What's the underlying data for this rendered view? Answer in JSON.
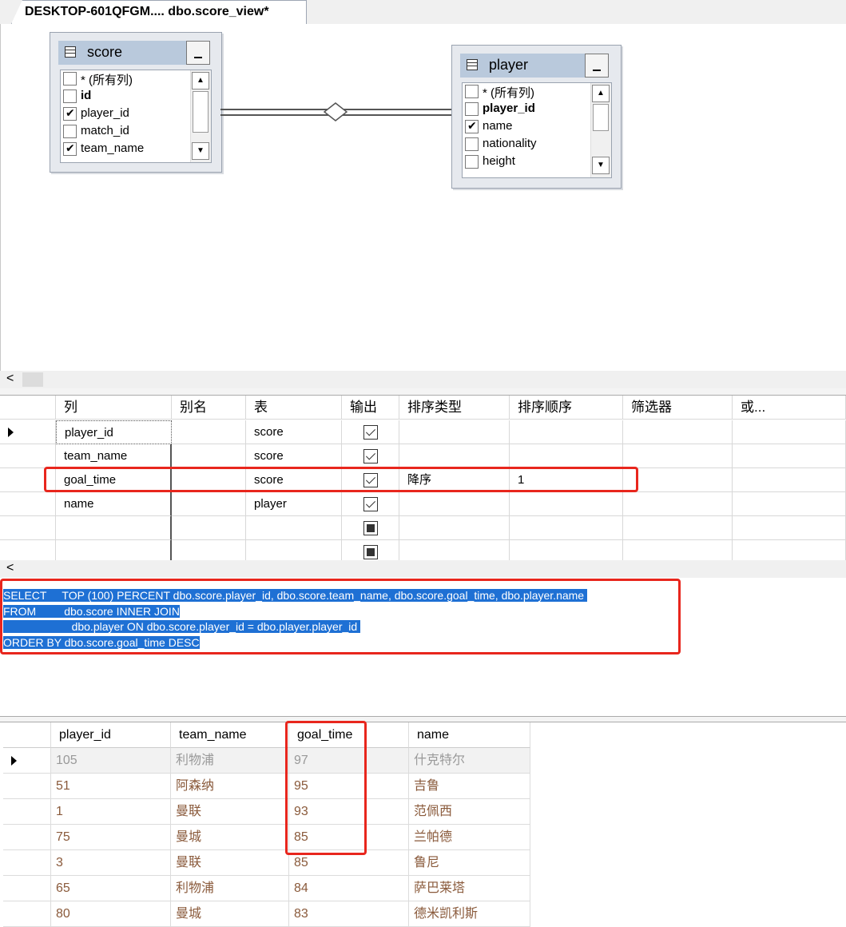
{
  "tab": {
    "title": "DESKTOP-601QFGM.... dbo.score_view*"
  },
  "diagram": {
    "score": {
      "title": "score",
      "columns": [
        {
          "label": "* (所有列)",
          "checked": false,
          "bold": false
        },
        {
          "label": "id",
          "checked": false,
          "bold": true
        },
        {
          "label": "player_id",
          "checked": true,
          "bold": false
        },
        {
          "label": "match_id",
          "checked": false,
          "bold": false
        },
        {
          "label": "team_name",
          "checked": true,
          "bold": false
        }
      ]
    },
    "player": {
      "title": "player",
      "columns": [
        {
          "label": "* (所有列)",
          "checked": false,
          "bold": false
        },
        {
          "label": "player_id",
          "checked": false,
          "bold": true
        },
        {
          "label": "name",
          "checked": true,
          "bold": false
        },
        {
          "label": "nationality",
          "checked": false,
          "bold": false
        },
        {
          "label": "height",
          "checked": false,
          "bold": false
        }
      ]
    }
  },
  "criteria": {
    "headers": [
      "列",
      "别名",
      "表",
      "输出",
      "排序类型",
      "排序顺序",
      "筛选器",
      "或..."
    ],
    "rows": [
      {
        "column": "player_id",
        "alias": "",
        "table": "score",
        "output": "checked",
        "sort_type": "",
        "sort_order": ""
      },
      {
        "column": "team_name",
        "alias": "",
        "table": "score",
        "output": "checked",
        "sort_type": "",
        "sort_order": ""
      },
      {
        "column": "goal_time",
        "alias": "",
        "table": "score",
        "output": "checked",
        "sort_type": "降序",
        "sort_order": "1"
      },
      {
        "column": "name",
        "alias": "",
        "table": "player",
        "output": "checked",
        "sort_type": "",
        "sort_order": ""
      },
      {
        "column": "",
        "alias": "",
        "table": "",
        "output": "indeterminate",
        "sort_type": "",
        "sort_order": ""
      },
      {
        "column": "",
        "alias": "",
        "table": "",
        "output": "indeterminate",
        "sort_type": "",
        "sort_order": ""
      }
    ]
  },
  "sql": {
    "lines": [
      "SELECT     TOP (100) PERCENT dbo.score.player_id, dbo.score.team_name, dbo.score.goal_time, dbo.player.name ",
      "FROM         dbo.score INNER JOIN",
      "                      dbo.player ON dbo.score.player_id = dbo.player.player_id ",
      "ORDER BY dbo.score.goal_time DESC"
    ]
  },
  "results": {
    "headers": [
      "player_id",
      "team_name",
      "goal_time",
      "name"
    ],
    "rows": [
      [
        "105",
        "利物浦",
        "97",
        "什克特尔"
      ],
      [
        "51",
        "阿森纳",
        "95",
        "吉鲁"
      ],
      [
        "1",
        "曼联",
        "93",
        "范佩西"
      ],
      [
        "75",
        "曼城",
        "85",
        "兰帕德"
      ],
      [
        "3",
        "曼联",
        "85",
        "鲁尼"
      ],
      [
        "65",
        "利物浦",
        "84",
        "萨巴莱塔"
      ],
      [
        "80",
        "曼城",
        "83",
        "德米凯利斯"
      ]
    ]
  },
  "colors": {
    "highlight_red": "#e8261d",
    "sql_selection": "#1e70d4",
    "result_text": "#8a5a3b"
  }
}
